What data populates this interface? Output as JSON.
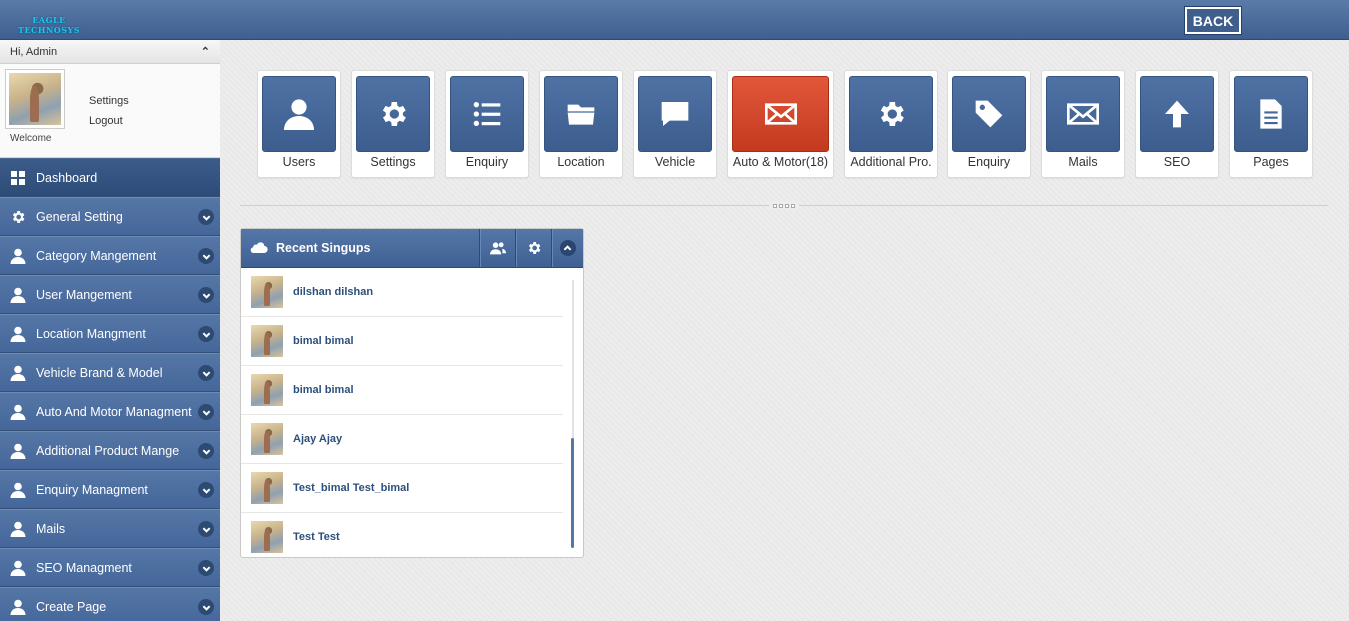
{
  "header": {
    "logo_text": "EAGLE TECHNOSYS",
    "back_label": "BACK"
  },
  "sidebar": {
    "greeting": "Hi, Admin",
    "settings_label": "Settings",
    "logout_label": "Logout",
    "welcome_label": "Welcome",
    "items": [
      {
        "label": "Dashboard",
        "icon": "dashboard-icon",
        "active": true
      },
      {
        "label": "General Setting",
        "icon": "gear-icon"
      },
      {
        "label": "Category Mangement",
        "icon": "user-icon"
      },
      {
        "label": "User Mangement",
        "icon": "user-icon"
      },
      {
        "label": "Location Mangment",
        "icon": "user-icon"
      },
      {
        "label": "Vehicle Brand & Model",
        "icon": "user-icon"
      },
      {
        "label": "Auto And Motor Managment",
        "icon": "user-icon"
      },
      {
        "label": "Additional Product Mange",
        "icon": "user-icon"
      },
      {
        "label": "Enquiry Managment",
        "icon": "user-icon"
      },
      {
        "label": "Mails",
        "icon": "user-icon"
      },
      {
        "label": "SEO Managment",
        "icon": "user-icon"
      },
      {
        "label": "Create Page",
        "icon": "user-icon"
      }
    ]
  },
  "tiles": [
    {
      "label": "Users",
      "icon": "user-icon"
    },
    {
      "label": "Settings",
      "icon": "gear-icon"
    },
    {
      "label": "Enquiry",
      "icon": "list-icon"
    },
    {
      "label": "Location",
      "icon": "folder-icon"
    },
    {
      "label": "Vehicle",
      "icon": "chat-icon"
    },
    {
      "label": "Auto & Motor(18)",
      "icon": "mail-icon",
      "highlight": "#d84a2c"
    },
    {
      "label": "Additional Pro.",
      "icon": "gear-icon"
    },
    {
      "label": "Enquiry",
      "icon": "tag-icon"
    },
    {
      "label": "Mails",
      "icon": "mail-icon"
    },
    {
      "label": "SEO",
      "icon": "arrow-up-icon"
    },
    {
      "label": "Pages",
      "icon": "document-icon"
    }
  ],
  "widget": {
    "title": "Recent Singups",
    "signups": [
      {
        "name": "dilshan dilshan"
      },
      {
        "name": "bimal bimal"
      },
      {
        "name": "bimal bimal"
      },
      {
        "name": "Ajay Ajay"
      },
      {
        "name": "Test_bimal Test_bimal"
      },
      {
        "name": "Test Test"
      }
    ]
  },
  "colors": {
    "primary": "#4a6a9c",
    "header": "#4d6d9e",
    "accent_red": "#d84a2c",
    "background": "#ededed"
  }
}
